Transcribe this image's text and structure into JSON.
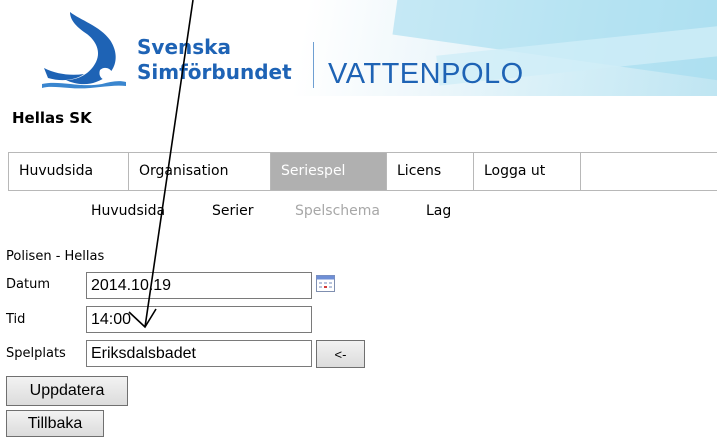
{
  "header": {
    "brand_line1": "Svenska",
    "brand_line2": "Simförbundet",
    "app_name": "VATTENPOLO",
    "brand_color": "#1e63b5"
  },
  "club_name": "Hellas SK",
  "tabs": [
    {
      "label": "Huvudsida",
      "active": false
    },
    {
      "label": "Organisation",
      "active": false
    },
    {
      "label": "Seriespel",
      "active": true
    },
    {
      "label": "Licens",
      "active": false
    },
    {
      "label": "Logga ut",
      "active": false
    }
  ],
  "subnav": [
    {
      "label": "Huvudsida",
      "disabled": false
    },
    {
      "label": "Serier",
      "disabled": false
    },
    {
      "label": "Spelschema",
      "disabled": true
    },
    {
      "label": "Lag",
      "disabled": false
    }
  ],
  "form": {
    "match_title": "Polisen - Hellas",
    "date_label": "Datum",
    "date_value": "2014.10.19",
    "time_label": "Tid",
    "time_value": "14:00",
    "venue_label": "Spelplats",
    "venue_value": "Eriksdalsbadet",
    "copy_button": "<-",
    "update_button": "Uppdatera",
    "back_button": "Tillbaka"
  },
  "icons": {
    "calendar": "calendar-icon",
    "logo": "swimmer-logo-icon",
    "annotation": "arrow-annotation"
  }
}
